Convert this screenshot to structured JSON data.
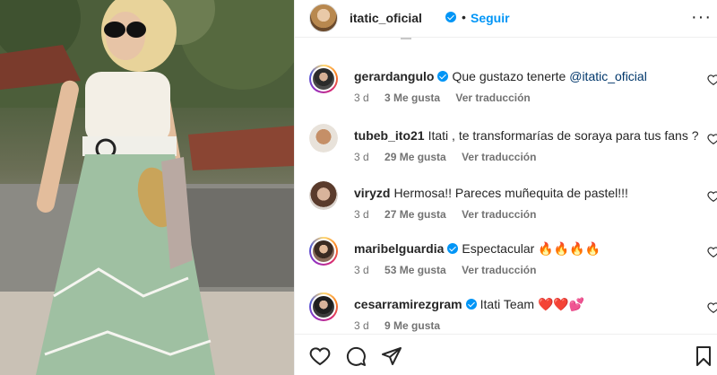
{
  "post": {
    "username": "itatic_oficial",
    "separator": "•",
    "follow_label": "Seguir",
    "more_label": "···"
  },
  "comments": [
    {
      "user": "gerardangulo",
      "verified": true,
      "text_before": "Que gustazo tenerte ",
      "mention": "@itatic_oficial",
      "text_after": "",
      "time": "3 d",
      "likes": "3 Me gusta",
      "translate": "Ver traducción"
    },
    {
      "user": "tubeb_ito21",
      "verified": false,
      "text_before": "Itati , te transformarías de soraya para tus fans ?",
      "mention": "",
      "text_after": "",
      "time": "3 d",
      "likes": "29 Me gusta",
      "translate": "Ver traducción"
    },
    {
      "user": "viryzd",
      "verified": false,
      "text_before": "Hermosa!! Pareces muñequita de pastel!!!",
      "mention": "",
      "text_after": "",
      "time": "3 d",
      "likes": "27 Me gusta",
      "translate": "Ver traducción"
    },
    {
      "user": "maribelguardia",
      "verified": true,
      "text_before": "Espectacular 🔥🔥🔥🔥",
      "mention": "",
      "text_after": "",
      "time": "3 d",
      "likes": "53 Me gusta",
      "translate": "Ver traducción"
    },
    {
      "user": "cesarramirezgram",
      "verified": true,
      "text_before": "Itati Team ❤️❤️💕",
      "mention": "",
      "text_after": "",
      "time": "3 d",
      "likes": "9 Me gusta",
      "translate": ""
    }
  ],
  "icons": {
    "like": "heart-icon",
    "comment": "comment-icon",
    "share": "share-icon",
    "save": "bookmark-icon"
  },
  "colors": {
    "accent": "#0095f6",
    "mention": "#00376b",
    "meta": "#737373"
  }
}
